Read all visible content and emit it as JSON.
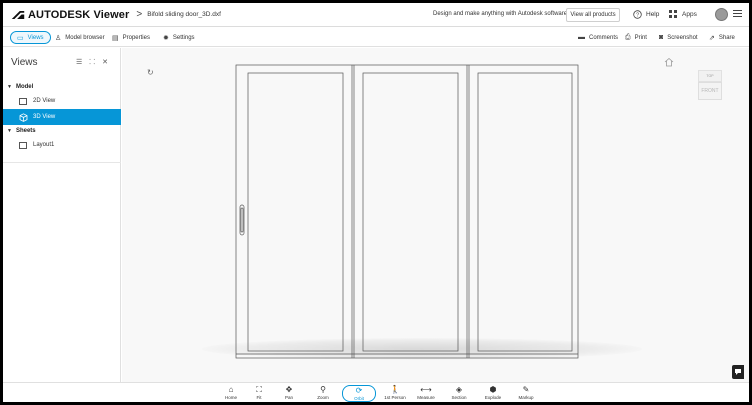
{
  "app": {
    "brand": "AUTODESK Viewer",
    "breadcrumb_separator": ">",
    "file_name": "Bifold sliding door_3D.dxf",
    "tagline": "Design and make anything with Autodesk software",
    "view_products_label": "View all products",
    "help_label": "Help",
    "apps_label": "Apps"
  },
  "toolbar": {
    "views_label": "Views",
    "model_browser_label": "Model browser",
    "properties_label": "Properties",
    "settings_label": "Settings",
    "comments_label": "Comments",
    "print_label": "Print",
    "screenshot_label": "Screenshot",
    "share_label": "Share"
  },
  "panel": {
    "title": "Views",
    "sections": [
      {
        "label": "Model",
        "items": [
          {
            "label": "2D View",
            "selected": false
          },
          {
            "label": "3D View",
            "selected": true
          }
        ]
      },
      {
        "label": "Sheets",
        "items": [
          {
            "label": "Layout1",
            "selected": false
          }
        ]
      }
    ]
  },
  "viewcube": {
    "top_label": "TOP",
    "front_label": "FRONT"
  },
  "bottombar": {
    "tools": [
      {
        "label": "Home",
        "icon": "home-icon"
      },
      {
        "label": "Fit",
        "icon": "fit-icon"
      },
      {
        "label": "Pan",
        "icon": "pan-icon"
      },
      {
        "label": "Zoom",
        "icon": "zoom-icon"
      },
      {
        "label": "Orbit",
        "icon": "orbit-icon",
        "active": true
      },
      {
        "label": "1st Person",
        "icon": "first-person-icon"
      },
      {
        "label": "Measure",
        "icon": "measure-icon"
      },
      {
        "label": "Section",
        "icon": "section-icon"
      },
      {
        "label": "Explode",
        "icon": "explode-icon"
      },
      {
        "label": "Markup",
        "icon": "markup-icon"
      }
    ]
  },
  "colors": {
    "accent": "#0696d7",
    "canvas_bg": "#f8f8f8",
    "frame": "#000000"
  }
}
